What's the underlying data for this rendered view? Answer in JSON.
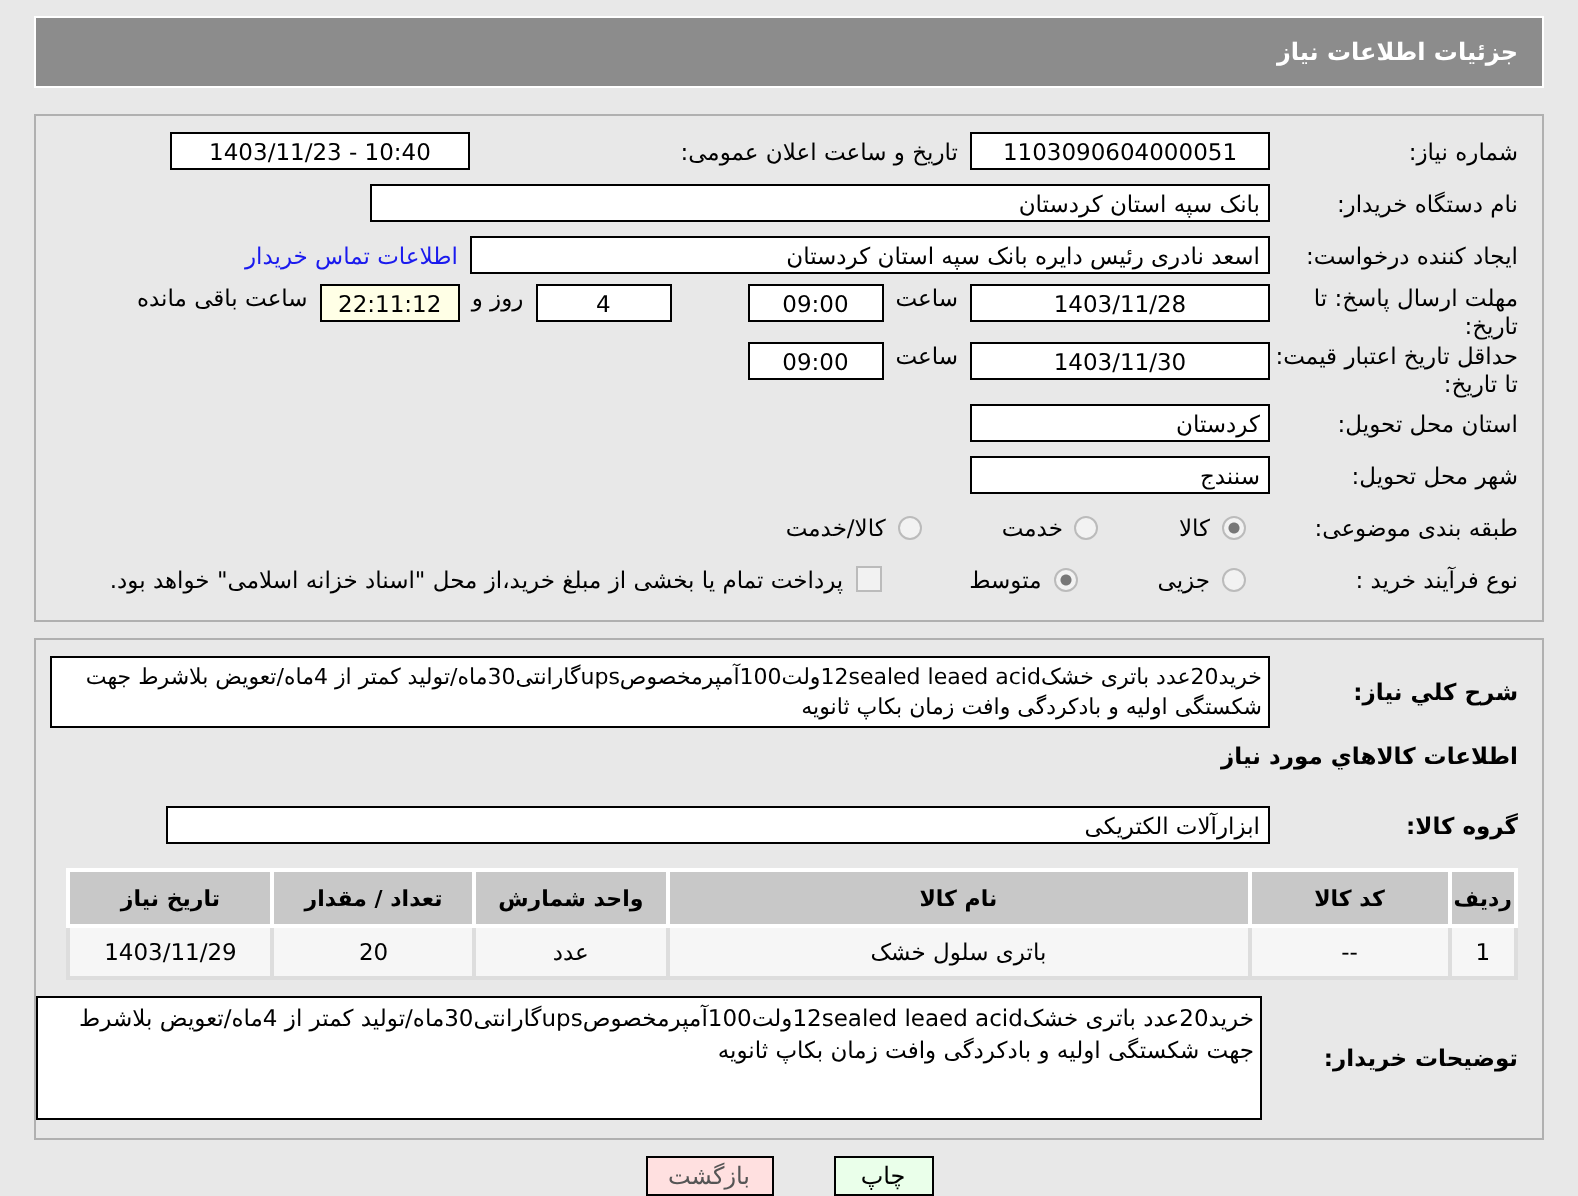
{
  "header": {
    "title": "جزئیات اطلاعات نیاز"
  },
  "need_number": {
    "label": "شماره نیاز:",
    "value": "1103090604000051"
  },
  "announce": {
    "label": "تاریخ و ساعت اعلان عمومی:",
    "value": "1403/11/23 - 10:40"
  },
  "buyer": {
    "label": "نام دستگاه خریدار:",
    "value": "بانک سپه استان کردستان"
  },
  "requester": {
    "label": "ایجاد کننده درخواست:",
    "value": "اسعد نادری رئیس دایره بانک سپه استان کردستان",
    "link": "اطلاعات تماس خریدار"
  },
  "deadline": {
    "label": "مهلت ارسال پاسخ: تا تاریخ:",
    "date": "1403/11/28",
    "time_label": "ساعت",
    "time": "09:00",
    "days": "4",
    "days_label": "روز و",
    "remaining": "22:11:12",
    "remaining_label": "ساعت باقی مانده"
  },
  "validity": {
    "label": "حداقل تاریخ اعتبار قیمت: تا تاریخ:",
    "date": "1403/11/30",
    "time_label": "ساعت",
    "time": "09:00"
  },
  "province": {
    "label": "استان محل تحویل:",
    "value": "کردستان"
  },
  "city": {
    "label": "شهر محل تحویل:",
    "value": "سنندج"
  },
  "category": {
    "label": "طبقه بندی موضوعی:",
    "options": [
      {
        "label": "کالا",
        "selected": true
      },
      {
        "label": "خدمت",
        "selected": false
      },
      {
        "label": "کالا/خدمت",
        "selected": false
      }
    ]
  },
  "process": {
    "label": "نوع فرآیند خرید :",
    "options": [
      {
        "label": "جزیی",
        "selected": false
      },
      {
        "label": "متوسط",
        "selected": true
      }
    ],
    "payment": {
      "label": "پرداخت تمام یا بخشی از مبلغ خرید،از محل \"اسناد خزانه اسلامی\" خواهد بود.",
      "checked": false
    }
  },
  "description": {
    "label": "شرح کلي نياز:",
    "value": "خرید20عدد باتری خشک12sealed leaed acidولت100آمپرمخصوصupsگارانتی30ماه/تولید کمتر از 4ماه/تعویض بلاشرط جهت شکستگی اولیه و بادکردگی وافت زمان بکاپ ثانویه"
  },
  "goods_title": "اطلاعات كالاهاي مورد نياز",
  "goods_group": {
    "label": "گروه کالا:",
    "value": "ابزارآلات الکتریکی"
  },
  "table": {
    "columns": [
      "ردیف",
      "کد کالا",
      "نام کالا",
      "واحد شمارش",
      "تعداد / مقدار",
      "تاریخ نیاز"
    ],
    "rows": [
      [
        "1",
        "--",
        "باتری سلول خشک",
        "عدد",
        "20",
        "1403/11/29"
      ]
    ]
  },
  "buyer_notes": {
    "label": "توضیحات خریدار:",
    "value": "خرید20عدد باتری خشک12sealed leaed acidولت100آمپرمخصوصupsگارانتی30ماه/تولید کمتر از 4ماه/تعویض بلاشرط جهت شکستگی اولیه و بادکردگی وافت زمان بکاپ ثانویه"
  },
  "buttons": [
    {
      "label": "چاپ",
      "kind": "print"
    },
    {
      "label": "بازگشت",
      "kind": "back"
    }
  ]
}
